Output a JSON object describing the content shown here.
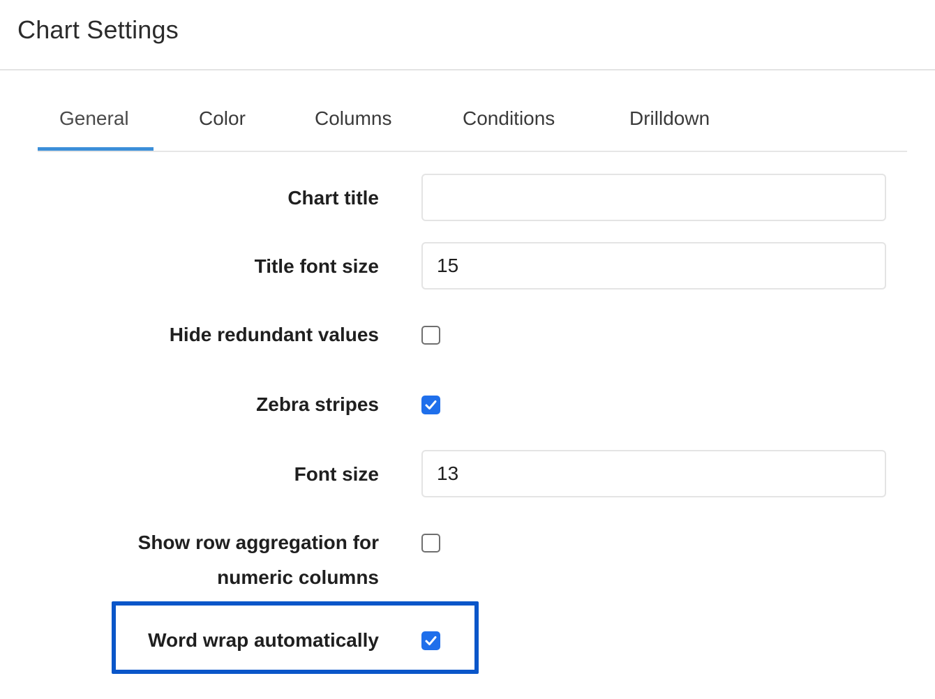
{
  "header": {
    "title": "Chart Settings"
  },
  "tabs": [
    {
      "label": "General",
      "active": true
    },
    {
      "label": "Color",
      "active": false
    },
    {
      "label": "Columns",
      "active": false
    },
    {
      "label": "Conditions",
      "active": false
    },
    {
      "label": "Drilldown",
      "active": false
    }
  ],
  "form": {
    "chart_title": {
      "label": "Chart title",
      "value": ""
    },
    "title_font_size": {
      "label": "Title font size",
      "value": "15"
    },
    "hide_redundant_values": {
      "label": "Hide redundant values",
      "checked": false
    },
    "zebra_stripes": {
      "label": "Zebra stripes",
      "checked": true
    },
    "font_size": {
      "label": "Font size",
      "value": "13"
    },
    "show_row_aggregation": {
      "label_line1": "Show row aggregation for",
      "label_line2": "numeric columns",
      "checked": false
    },
    "word_wrap": {
      "label": "Word wrap automatically",
      "checked": true
    }
  },
  "colors": {
    "accent": "#1f6feb",
    "tab_indicator": "#3b8fd9",
    "highlight": "#0a56c9"
  },
  "icons": {
    "check": "check-icon"
  }
}
